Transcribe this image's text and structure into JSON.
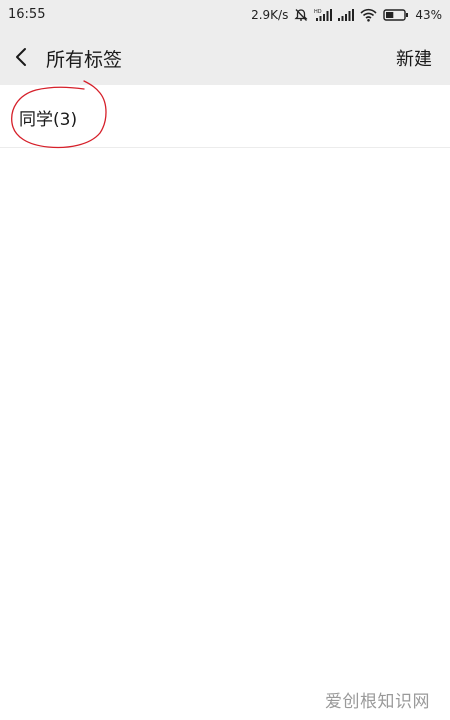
{
  "status_bar": {
    "time": "16:55",
    "network_speed": "2.9K/s",
    "battery_percent": "43%",
    "battery_level": 0.43,
    "icons": [
      "mute-icon",
      "hd-signal-icon",
      "signal-icon",
      "wifi-icon",
      "battery-icon"
    ]
  },
  "header": {
    "title": "所有标签",
    "new_label": "新建"
  },
  "tags": [
    {
      "label": "同学(3)"
    }
  ],
  "annotation_color": "#d6202a",
  "watermark": "爱创根知识网"
}
